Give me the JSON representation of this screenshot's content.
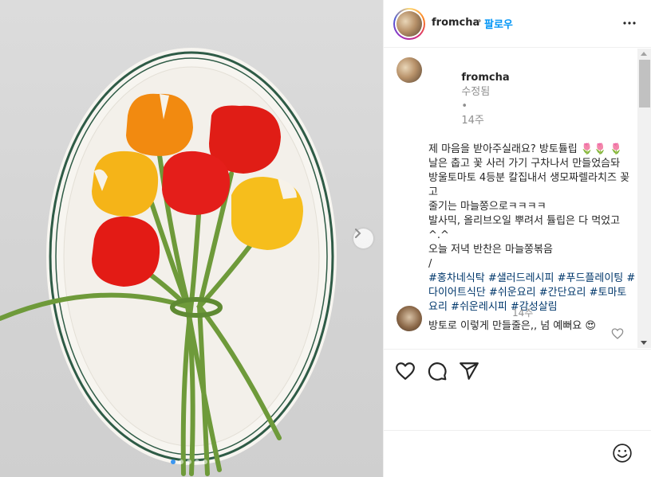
{
  "post": {
    "carousel": {
      "slide_count": 5,
      "active_index": 0
    }
  },
  "header": {
    "username": "fromcha",
    "separator": "•",
    "follow_label": "팔로우"
  },
  "caption": {
    "username": "fromcha",
    "edited_label": "수정됨",
    "separator": "•",
    "time": "14주",
    "lines": [
      "제 마음을 받아주실래요? 방토튤립 🌷🌷 🌷",
      "날은 춥고 꽃 사러 가기 구차나서 만들었슴돠",
      "방울토마토 4등분 칼집내서 생모짜렐라치즈 꽂고",
      "줄기는 마늘쫑으로ㅋㅋㅋㅋ",
      "발사믹, 올리브오일 뿌려서 튤립은 다 먹었고^.^",
      "오늘 저녁 반찬은 마늘쫑볶음",
      "/"
    ],
    "hashtags": "#홍차네식탁 #샐러드레시피 #푸드플레이팅 #다이어트식단 #쉬운요리 #간단요리 #토마토요리 #쉬운레시피 #감성살림"
  },
  "comment": {
    "time": "14주",
    "text": "방토로 이렇게 만들줄은,, 넘 예뻐요 😍"
  }
}
